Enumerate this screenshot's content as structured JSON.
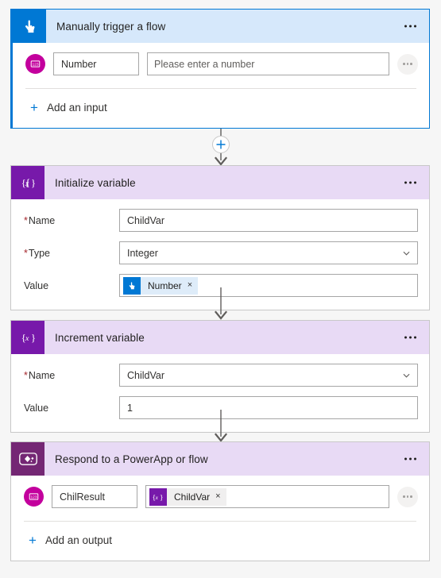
{
  "flow": {
    "cards": [
      {
        "id": "trigger",
        "title": "Manually trigger a flow",
        "icon": "touch-trigger-icon",
        "selected": true,
        "io_row": {
          "icon": "number-input-icon",
          "name": "Number",
          "value": "Please enter a number",
          "more_label": "..."
        },
        "add_label": "Add an input",
        "add_plus": "+"
      },
      {
        "id": "initialize-variable",
        "title": "Initialize variable",
        "icon": "variable-icon",
        "fields": [
          {
            "label": "Name",
            "required": true,
            "value": "ChildVar",
            "type": "text"
          },
          {
            "label": "Type",
            "required": true,
            "value": "Integer",
            "type": "dropdown"
          },
          {
            "label": "Value",
            "required": false,
            "type": "token",
            "token": {
              "text": "Number",
              "icon": "touch-trigger-icon",
              "color": "blue",
              "remove": "×"
            }
          }
        ]
      },
      {
        "id": "increment-variable",
        "title": "Increment variable",
        "icon": "variable-icon",
        "fields": [
          {
            "label": "Name",
            "required": true,
            "value": "ChildVar",
            "type": "dropdown"
          },
          {
            "label": "Value",
            "required": false,
            "value": "1",
            "type": "text"
          }
        ]
      },
      {
        "id": "respond-to-powerapp",
        "title": "Respond to a PowerApp or flow",
        "icon": "powerapps-icon",
        "io_row": {
          "icon": "number-output-icon",
          "name": "ChilResult",
          "token": {
            "text": "ChildVar",
            "icon": "variable-icon",
            "color": "purple",
            "remove": "×"
          },
          "more_label": "..."
        },
        "add_label": "Add an output",
        "add_plus": "+"
      }
    ]
  },
  "colors": {
    "accent_blue": "#0078d4",
    "trigger_header": "#d6e8fb",
    "variable_header": "#e8daf5",
    "variable_icon": "#7719aa",
    "powerapp_icon": "#742774",
    "io_icon_magenta": "#c3009d",
    "required_star": "#a4262c",
    "canvas_background": "#f6f6f6",
    "arrow_gray": "#605e5c"
  }
}
